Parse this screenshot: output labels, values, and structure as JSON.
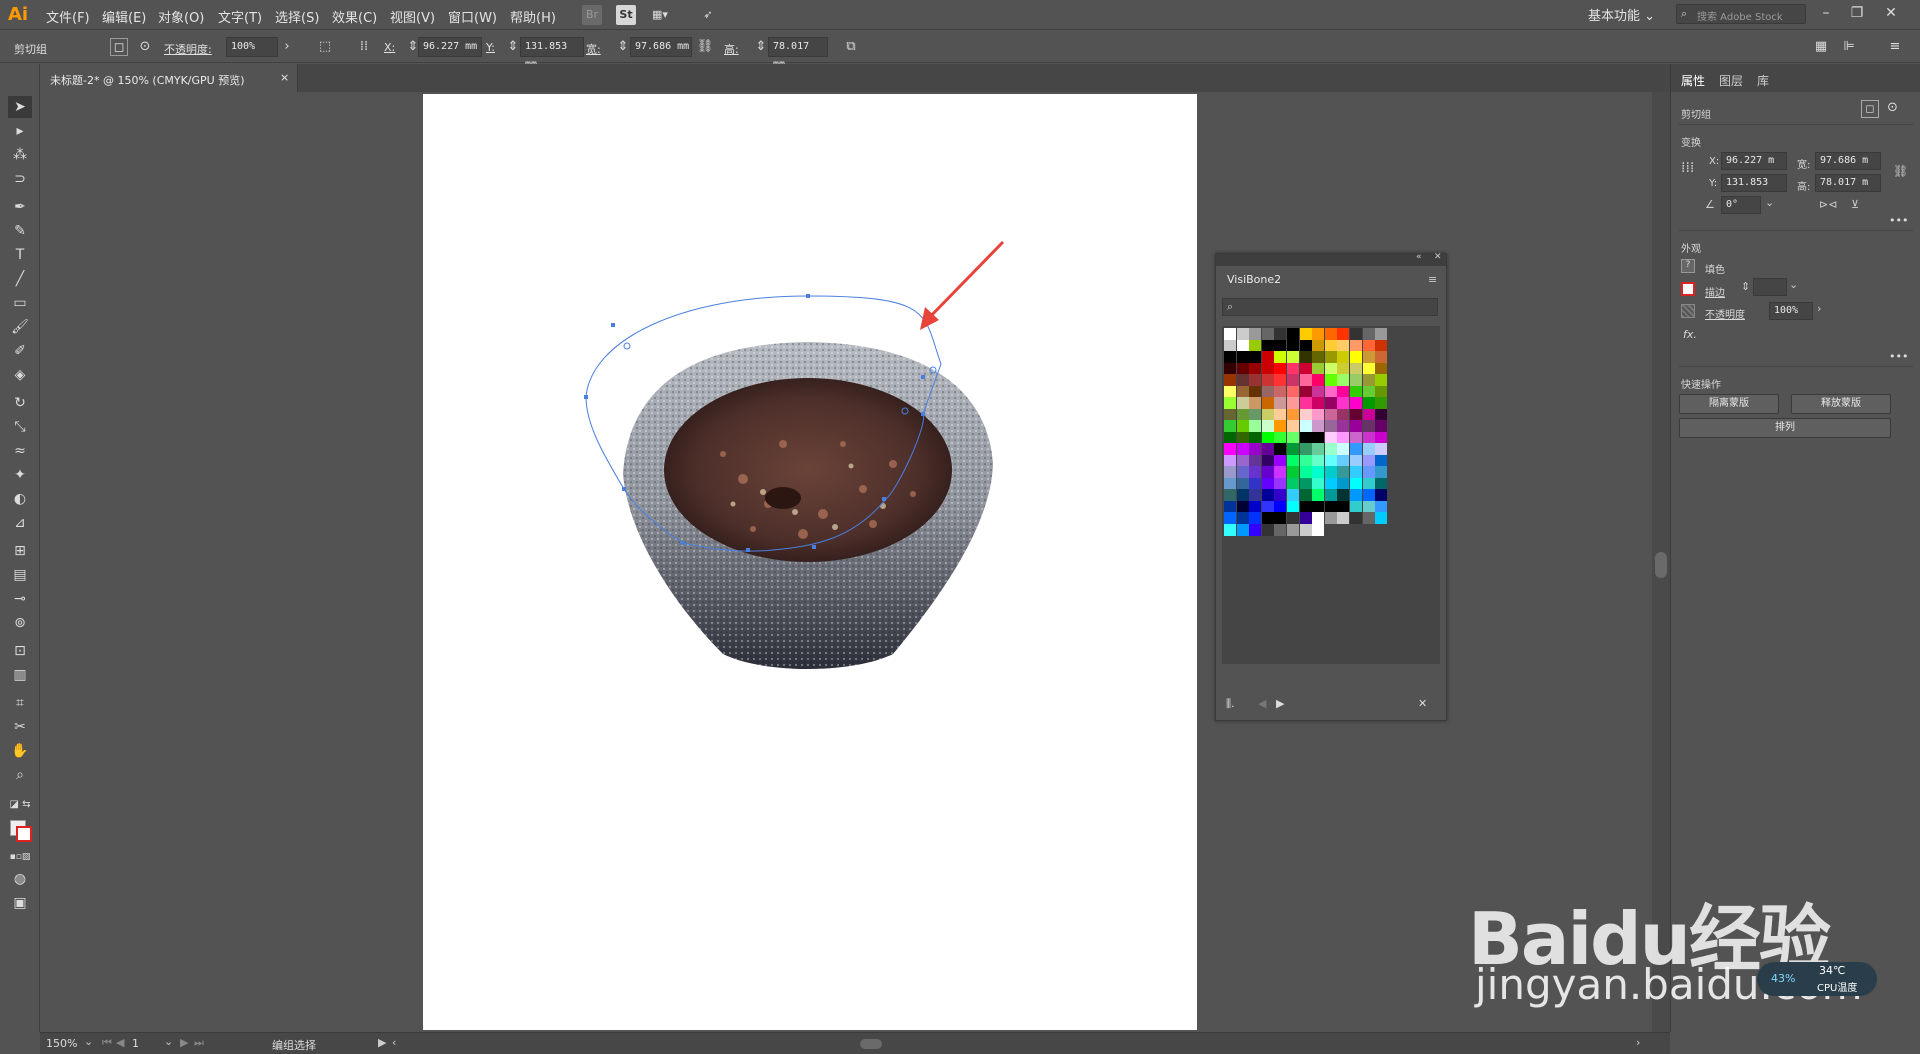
{
  "app": {
    "logo": "Ai"
  },
  "menu": [
    "文件(F)",
    "编辑(E)",
    "对象(O)",
    "文字(T)",
    "选择(S)",
    "效果(C)",
    "视图(V)",
    "窗口(W)",
    "帮助(H)"
  ],
  "topbar": {
    "bridge_label": "Br",
    "stock_label": "St",
    "workspace": "基本功能",
    "search_placeholder": "搜索 Adobe Stock"
  },
  "control": {
    "selection_type": "剪切组",
    "opacity_label": "不透明度:",
    "opacity_value": "100%",
    "x_label": "X:",
    "x_value": "96.227 mm",
    "y_label": "Y:",
    "y_value": "131.853 mm",
    "w_label": "宽:",
    "w_value": "97.686 mm",
    "h_label": "高:",
    "h_value": "78.017 mm"
  },
  "document_tab": {
    "title": "未标题-2* @ 150% (CMYK/GPU 预览)",
    "close": "×"
  },
  "swatch_panel": {
    "title": "VisiBone2"
  },
  "right_panel": {
    "tabs": [
      "属性",
      "图层",
      "库"
    ],
    "selection_type": "剪切组",
    "transform_header": "变换",
    "x_label": "X:",
    "x_value": "96.227 m",
    "y_label": "Y:",
    "y_value": "131.853",
    "w_label": "宽:",
    "w_value": "97.686 m",
    "h_label": "高:",
    "h_value": "78.017 m",
    "angle_value": "0°",
    "appearance_header": "外观",
    "fill_label": "填色",
    "stroke_label": "描边",
    "opacity_label": "不透明度",
    "opacity_value": "100%",
    "fx_label": "fx.",
    "quick_actions_header": "快速操作",
    "btn_isolate": "隔离蒙版",
    "btn_release": "释放蒙版",
    "btn_arrange": "排列"
  },
  "status": {
    "zoom": "150%",
    "artboard_num": "1",
    "tool_text": "编组选择"
  },
  "watermark": {
    "brand": "Baidu经验",
    "url": "jingyan.baidu.com",
    "cpu_temp": "34℃",
    "cpu_label": "CPU温度",
    "cpu_pct": "43%"
  },
  "colors": {
    "accent": "#ff9a00",
    "bg": "#535353",
    "arrow": "#e8433a",
    "selection": "#4a7fe0"
  },
  "swatch_colors": [
    "#ffffff",
    "#cccccc",
    "#999999",
    "#666666",
    "#333333",
    "#000000",
    "#ffcc00",
    "#ff9900",
    "#ff6600",
    "#ff3300",
    "#333333",
    "#666666",
    "#999999",
    "#cccccc",
    "#ffffff",
    "#99cc00",
    "#000000",
    "#000000",
    "#000000",
    "#000000",
    "#cc9900",
    "#ffcc33",
    "#ffcc66",
    "#ff9966",
    "#ff6633",
    "#cc3300",
    "#000000",
    "#000000",
    "#000000",
    "#cc0000",
    "#ccff00",
    "#ccff33",
    "#333300",
    "#666600",
    "#999900",
    "#cccc00",
    "#ffff00",
    "#cc9933",
    "#cc6633",
    "#330000",
    "#660000",
    "#990000",
    "#cc0000",
    "#ff0000",
    "#ff3366",
    "#cc0033",
    "#99cc33",
    "#ccff66",
    "#cccc33",
    "#cccc66",
    "#ffff33",
    "#996600",
    "#993300",
    "#663333",
    "#993333",
    "#cc3333",
    "#ff3333",
    "#cc3366",
    "#ff6699",
    "#ff0066",
    "#66ff00",
    "#99ff66",
    "#99cc66",
    "#999933",
    "#99cc00",
    "#ffff66",
    "#996633",
    "#663300",
    "#996666",
    "#cc6666",
    "#ff6666",
    "#990033",
    "#cc3399",
    "#ff66cc",
    "#ff0099",
    "#33cc00",
    "#66cc33",
    "#669900",
    "#99ff33",
    "#cccc99",
    "#cc9966",
    "#cc6600",
    "#cc9999",
    "#ff9999",
    "#ff3399",
    "#cc0066",
    "#990066",
    "#ff33cc",
    "#ff00cc",
    "#009900",
    "#339900",
    "#666633",
    "#669933",
    "#669966",
    "#cccc66",
    "#ffcc99",
    "#ff9933",
    "#ffcccc",
    "#ff99cc",
    "#cc6699",
    "#993366",
    "#660033",
    "#cc0099",
    "#330033",
    "#33cc33",
    "#66cc00",
    "#99ff99",
    "#ccffcc",
    "#ff9900",
    "#ffcc99",
    "#ccffff",
    "#cc99cc",
    "#996699",
    "#993399",
    "#990099",
    "#663366",
    "#660066",
    "#006600",
    "#336600",
    "#006600",
    "#00ff00",
    "#33ff33",
    "#66ff66",
    "#000000",
    "#000000",
    "#ffccff",
    "#ff99ff",
    "#cc66cc",
    "#cc33cc",
    "#cc00cc",
    "#ff00ff",
    "#cc00ff",
    "#9900cc",
    "#660099",
    "#000000",
    "#009933",
    "#339966",
    "#66cc99",
    "#99ffcc",
    "#ccffff",
    "#3399ff",
    "#99ccff",
    "#ccccff",
    "#cc99ff",
    "#9966cc",
    "#663399",
    "#330066",
    "#9900ff",
    "#00ff66",
    "#33ff99",
    "#66ffcc",
    "#66ffff",
    "#66ccff",
    "#99ccff",
    "#9999ff",
    "#0066cc",
    "#9999cc",
    "#6666cc",
    "#6633cc",
    "#6600cc",
    "#cc33ff",
    "#00cc33",
    "#00ff99",
    "#00ffcc",
    "#00cccc",
    "#339999",
    "#33ccff",
    "#6699ff",
    "#3399cc",
    "#6699cc",
    "#336699",
    "#3333cc",
    "#6600ff",
    "#9933ff",
    "#00cc66",
    "#009966",
    "#33ffcc",
    "#00ccff",
    "#0099cc",
    "#00ffff",
    "#33cccc",
    "#006666",
    "#336666",
    "#003366",
    "#333399",
    "#000099",
    "#3300cc",
    "#33ccff",
    "#006633",
    "#00ff66",
    "#009999",
    "#003333",
    "#0099ff",
    "#0066ff",
    "#000066",
    "#003399",
    "#000033",
    "#0000cc",
    "#3333ff",
    "#0000ff",
    "#00ffff",
    "#000000",
    "#000000",
    "#000000",
    "#000000",
    "#33cccc",
    "#66cccc",
    "#3399ff",
    "#0066ff",
    "#003399",
    "#0033ff",
    "#000000",
    "#000000",
    "#333333",
    "#330099",
    "#ffffff",
    "#999999",
    "#cccccc",
    "#333333",
    "#666666",
    "#00ccff",
    "#33ffff",
    "#0099ff",
    "#3300ff",
    "#333333",
    "#666666",
    "#999999",
    "#cccccc",
    "#ffffff"
  ]
}
